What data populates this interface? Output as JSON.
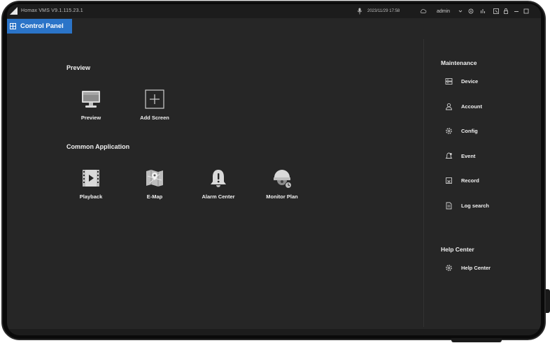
{
  "titlebar": {
    "app_title": "Homax  VMS  V9.1.115.23.1",
    "datetime": "2023/11/29  17:58",
    "user": "admin"
  },
  "tab": {
    "label": "Control Panel"
  },
  "preview_section": {
    "title": "Preview",
    "items": [
      {
        "label": "Preview",
        "icon": "monitor-icon"
      },
      {
        "label": "Add Screen",
        "icon": "add-screen-icon"
      }
    ]
  },
  "common_section": {
    "title": "Common Application",
    "items": [
      {
        "label": "Playback",
        "icon": "film-play-icon"
      },
      {
        "label": "E-Map",
        "icon": "map-icon"
      },
      {
        "label": "Alarm Center",
        "icon": "alarm-bell-icon"
      },
      {
        "label": "Monitor Plan",
        "icon": "camera-dome-icon"
      }
    ]
  },
  "maintenance": {
    "title": "Maintenance",
    "items": [
      {
        "label": "Device",
        "icon": "device-icon"
      },
      {
        "label": "Account",
        "icon": "user-icon"
      },
      {
        "label": "Config",
        "icon": "gear-icon"
      },
      {
        "label": "Event",
        "icon": "event-bell-icon"
      },
      {
        "label": "Record",
        "icon": "record-icon"
      },
      {
        "label": "Log search",
        "icon": "document-icon"
      }
    ]
  },
  "help": {
    "title": "Help Center",
    "items": [
      {
        "label": "Help Center",
        "icon": "gear-icon"
      }
    ]
  },
  "colors": {
    "accent": "#2b74c8",
    "background": "#262626",
    "titlebar": "#1c1c1c"
  }
}
